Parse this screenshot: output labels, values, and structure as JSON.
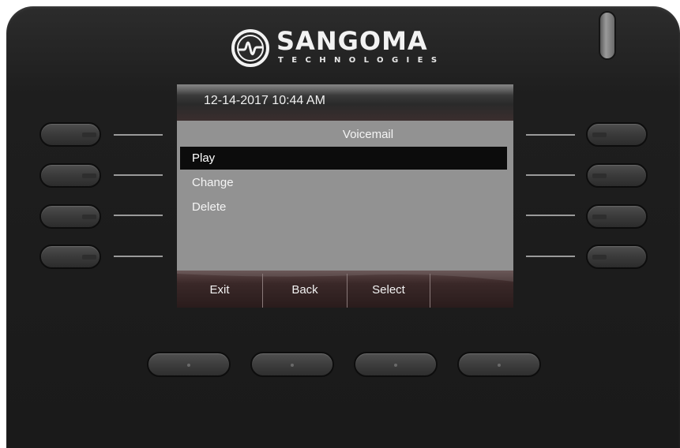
{
  "brand": {
    "name": "SANGOMA",
    "tagline": "TECHNOLOGIES",
    "icon": "sangoma-logo-icon"
  },
  "screen": {
    "datetime": "12-14-2017 10:44 AM",
    "title": "Voicemail",
    "menu": [
      {
        "label": "Play",
        "selected": true
      },
      {
        "label": "Change",
        "selected": false
      },
      {
        "label": "Delete",
        "selected": false
      }
    ],
    "softkeys": [
      {
        "label": "Exit"
      },
      {
        "label": "Back"
      },
      {
        "label": "Select"
      },
      {
        "label": ""
      }
    ]
  },
  "colors": {
    "body": "#1e1e1e",
    "screen_bg": "#929292",
    "selection": "#0c0c0c",
    "softkey_bar": "#3a2828"
  }
}
